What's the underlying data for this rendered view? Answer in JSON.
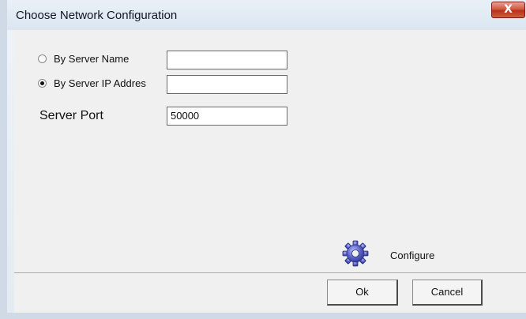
{
  "window": {
    "title": "Choose Network Configuration",
    "close_label": "X"
  },
  "connection": {
    "options": [
      {
        "label": "By Server Name",
        "selected": false,
        "value": ""
      },
      {
        "label": "By Server IP Addres",
        "selected": true,
        "value": ""
      }
    ]
  },
  "port": {
    "label": "Server Port",
    "value": "50000"
  },
  "configure": {
    "icon": "gear-icon",
    "label": "Configure"
  },
  "footer": {
    "ok_label": "Ok",
    "cancel_label": "Cancel"
  },
  "colors": {
    "dialog_background": "#f0f0f0",
    "title_bar": "#dbe6f1",
    "close_button": "#c7402b",
    "gear": "#5b63c8"
  }
}
